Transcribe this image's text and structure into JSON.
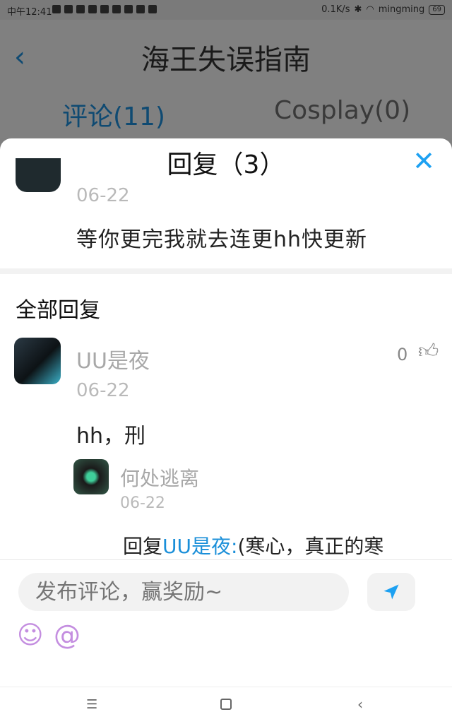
{
  "status_bar": {
    "time": "中午12:41",
    "network_speed": "0.1K/s",
    "wifi_name": "mingming",
    "battery": "69"
  },
  "header": {
    "title": "海王失误指南",
    "tabs": [
      {
        "label": "评论(11)",
        "active": true
      },
      {
        "label": "Cosplay(0)",
        "active": false
      }
    ]
  },
  "reply_sheet": {
    "title": "回复（3）",
    "original_comment": {
      "date": "06-22",
      "text": "等你更完我就去连更hh快更新"
    },
    "section_label": "全部回复",
    "replies": [
      {
        "username": "UU是夜",
        "date": "06-22",
        "text": "hh，刑",
        "likes": "0",
        "sub_reply": {
          "username": "何处逃离",
          "date": "06-22",
          "prefix": "回复",
          "mention": "UU是夜:",
          "text": "(寒心，真正的寒"
        }
      }
    ]
  },
  "composer": {
    "placeholder": "发布评论，赢奖励~"
  },
  "colors": {
    "accent": "#1da1f2",
    "mention": "#1a8fd9",
    "emoji": "#c48ee0"
  }
}
